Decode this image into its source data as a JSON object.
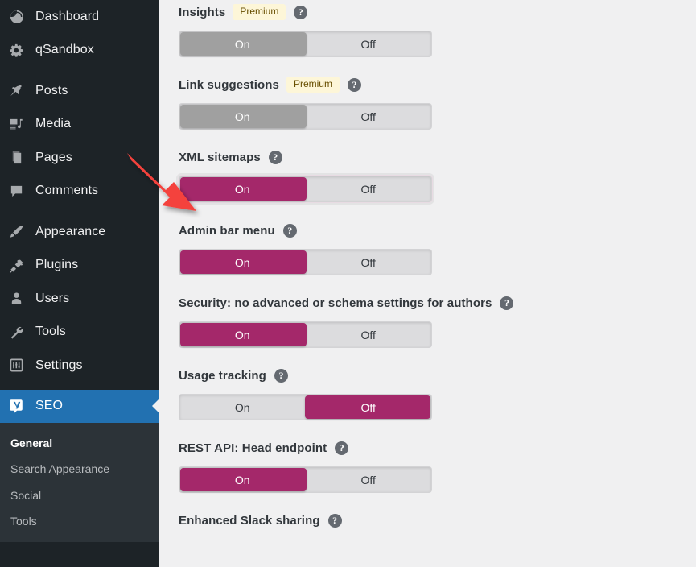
{
  "sidebar": {
    "items": [
      {
        "label": "Dashboard",
        "icon": "dashboard-icon",
        "active": false
      },
      {
        "label": "qSandbox",
        "icon": "gear-icon",
        "active": false
      },
      {
        "label": "Posts",
        "icon": "pin-icon",
        "active": false
      },
      {
        "label": "Media",
        "icon": "media-icon",
        "active": false
      },
      {
        "label": "Pages",
        "icon": "pages-icon",
        "active": false
      },
      {
        "label": "Comments",
        "icon": "comments-icon",
        "active": false
      },
      {
        "label": "Appearance",
        "icon": "brush-icon",
        "active": false
      },
      {
        "label": "Plugins",
        "icon": "plug-icon",
        "active": false
      },
      {
        "label": "Users",
        "icon": "user-icon",
        "active": false
      },
      {
        "label": "Tools",
        "icon": "wrench-icon",
        "active": false
      },
      {
        "label": "Settings",
        "icon": "settings-icon",
        "active": false
      },
      {
        "label": "SEO",
        "icon": "yoast-logo-icon",
        "active": true
      }
    ],
    "submenu": [
      {
        "label": "General",
        "current": true
      },
      {
        "label": "Search Appearance",
        "current": false
      },
      {
        "label": "Social",
        "current": false
      },
      {
        "label": "Tools",
        "current": false
      }
    ],
    "colors": {
      "background": "#1d2327",
      "submenu_background": "#2c3338",
      "active_background": "#2271b1"
    }
  },
  "main": {
    "background": "#f0f0f1",
    "toggle_on_label": "On",
    "toggle_off_label": "Off",
    "help_glyph": "?",
    "premium_badge": "Premium",
    "accent_color": "#a4286a",
    "settings": [
      {
        "label": "Insights",
        "premium": true,
        "state": "on",
        "disabled": true,
        "focused": false
      },
      {
        "label": "Link suggestions",
        "premium": true,
        "state": "on",
        "disabled": true,
        "focused": false
      },
      {
        "label": "XML sitemaps",
        "premium": false,
        "state": "on",
        "disabled": false,
        "focused": true
      },
      {
        "label": "Admin bar menu",
        "premium": false,
        "state": "on",
        "disabled": false,
        "focused": false
      },
      {
        "label": "Security: no advanced or schema settings for authors",
        "premium": false,
        "state": "on",
        "disabled": false,
        "focused": false
      },
      {
        "label": "Usage tracking",
        "premium": false,
        "state": "off",
        "disabled": false,
        "focused": false
      },
      {
        "label": "REST API: Head endpoint",
        "premium": false,
        "state": "on",
        "disabled": false,
        "focused": false
      },
      {
        "label": "Enhanced Slack sharing",
        "premium": false,
        "state": "on",
        "disabled": false,
        "focused": false,
        "clipped": true
      }
    ]
  },
  "annotation": {
    "arrow_color": "#f4433c",
    "points_to": "XML sitemaps On toggle"
  }
}
